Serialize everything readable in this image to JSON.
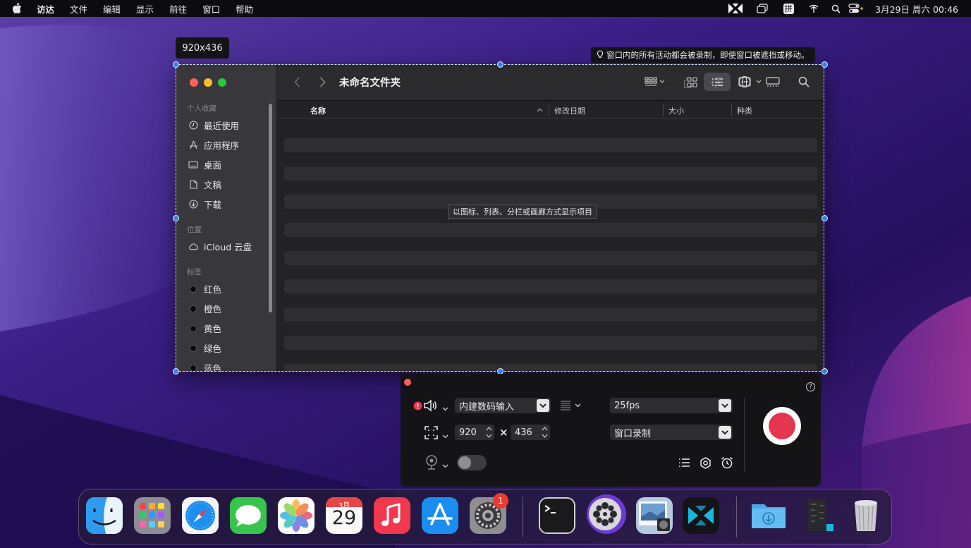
{
  "menubar": {
    "items": [
      "访达",
      "文件",
      "编辑",
      "显示",
      "前往",
      "窗口",
      "帮助"
    ],
    "clock": "3月29日 周六  00:46",
    "input_method": "拼"
  },
  "selection": {
    "size_label": "920x436",
    "notice": "窗口内的所有活动都会被录制，即使窗口被遮挡或移动。"
  },
  "finder": {
    "title": "未命名文件夹",
    "sidebar": {
      "favorites_header": "个人收藏",
      "favorites": [
        "最近使用",
        "应用程序",
        "桌面",
        "文稿",
        "下载"
      ],
      "locations_header": "位置",
      "locations": [
        "iCloud 云盘"
      ],
      "tags_header": "标签",
      "tags": [
        "红色",
        "橙色",
        "黄色",
        "绿色",
        "蓝色"
      ]
    },
    "columns": [
      "名称",
      "修改日期",
      "大小",
      "种类"
    ],
    "tooltip": "以图标、列表、分栏或画廊方式显示项目"
  },
  "recorder": {
    "audio_source": "内建数码输入",
    "fps": "25fps",
    "width": "920",
    "times": "×",
    "height": "436",
    "mode": "窗口录制",
    "help": "?"
  },
  "dock": {
    "calendar_month": "3月",
    "calendar_day": "29",
    "settings_badge": "1"
  },
  "colors": {
    "accent": "#3a7df0",
    "record": "#e5364f",
    "close": "#ff5f57",
    "minimize": "#febc2e",
    "zoom": "#28c840"
  }
}
